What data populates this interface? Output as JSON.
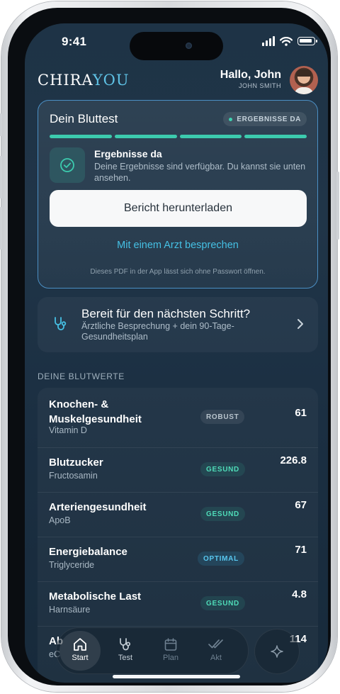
{
  "status_bar": {
    "time": "9:41"
  },
  "header": {
    "logo_part1": "CHIRA",
    "logo_part2": "YOU",
    "greeting": "Hallo, John",
    "user_name": "JOHN SMITH"
  },
  "bloodtest": {
    "title": "Dein Bluttest",
    "status": "ERGEBNISSE DA",
    "progress_steps_complete": 4,
    "progress_steps_total": 4,
    "results_title": "Ergebnisse da",
    "results_desc": "Deine Ergebnisse sind verfügbar. Du kannst sie unten ansehen.",
    "download_label": "Bericht herunterladen",
    "doctor_link": "Mit einem Arzt besprechen",
    "pdf_note": "Dieses PDF in der App lässt sich ohne Passwort öffnen."
  },
  "next_step": {
    "title": "Bereit für den nächsten Schritt?",
    "desc": "Ärztliche Besprechung + dein 90-Tage-Gesundheitsplan"
  },
  "values_section": {
    "label": "DEINE BLUTWERTE",
    "rows": [
      {
        "name": "Knochen- & Muskelgesundheit",
        "sub": "Vitamin D",
        "badge": "ROBUST",
        "value": "61"
      },
      {
        "name": "Blutzucker",
        "sub": "Fructosamin",
        "badge": "GESUND",
        "value": "226.8"
      },
      {
        "name": "Arteriengesundheit",
        "sub": "ApoB",
        "badge": "GESUND",
        "value": "67"
      },
      {
        "name": "Energiebalance",
        "sub": "Triglyceride",
        "badge": "OPTIMAL",
        "value": "71"
      },
      {
        "name": "Metabolische Last",
        "sub": "Harnsäure",
        "badge": "GESUND",
        "value": "4.8"
      },
      {
        "name": "Ab",
        "sub": "eC",
        "badge": "",
        "value": "114"
      }
    ]
  },
  "tabbar": {
    "tabs": [
      {
        "label": "Start",
        "icon": "home-icon",
        "active": true
      },
      {
        "label": "Test",
        "icon": "stethoscope-icon",
        "active": false
      },
      {
        "label": "Plan",
        "icon": "calendar-icon",
        "active": false
      },
      {
        "label": "Akt",
        "icon": "double-check-icon",
        "active": false
      }
    ],
    "fab_icon": "sparkle-icon"
  },
  "colors": {
    "accent_teal": "#3ccbae",
    "accent_blue": "#45c0e4",
    "card_border": "#4b8fc4",
    "background": "#1e3346"
  }
}
